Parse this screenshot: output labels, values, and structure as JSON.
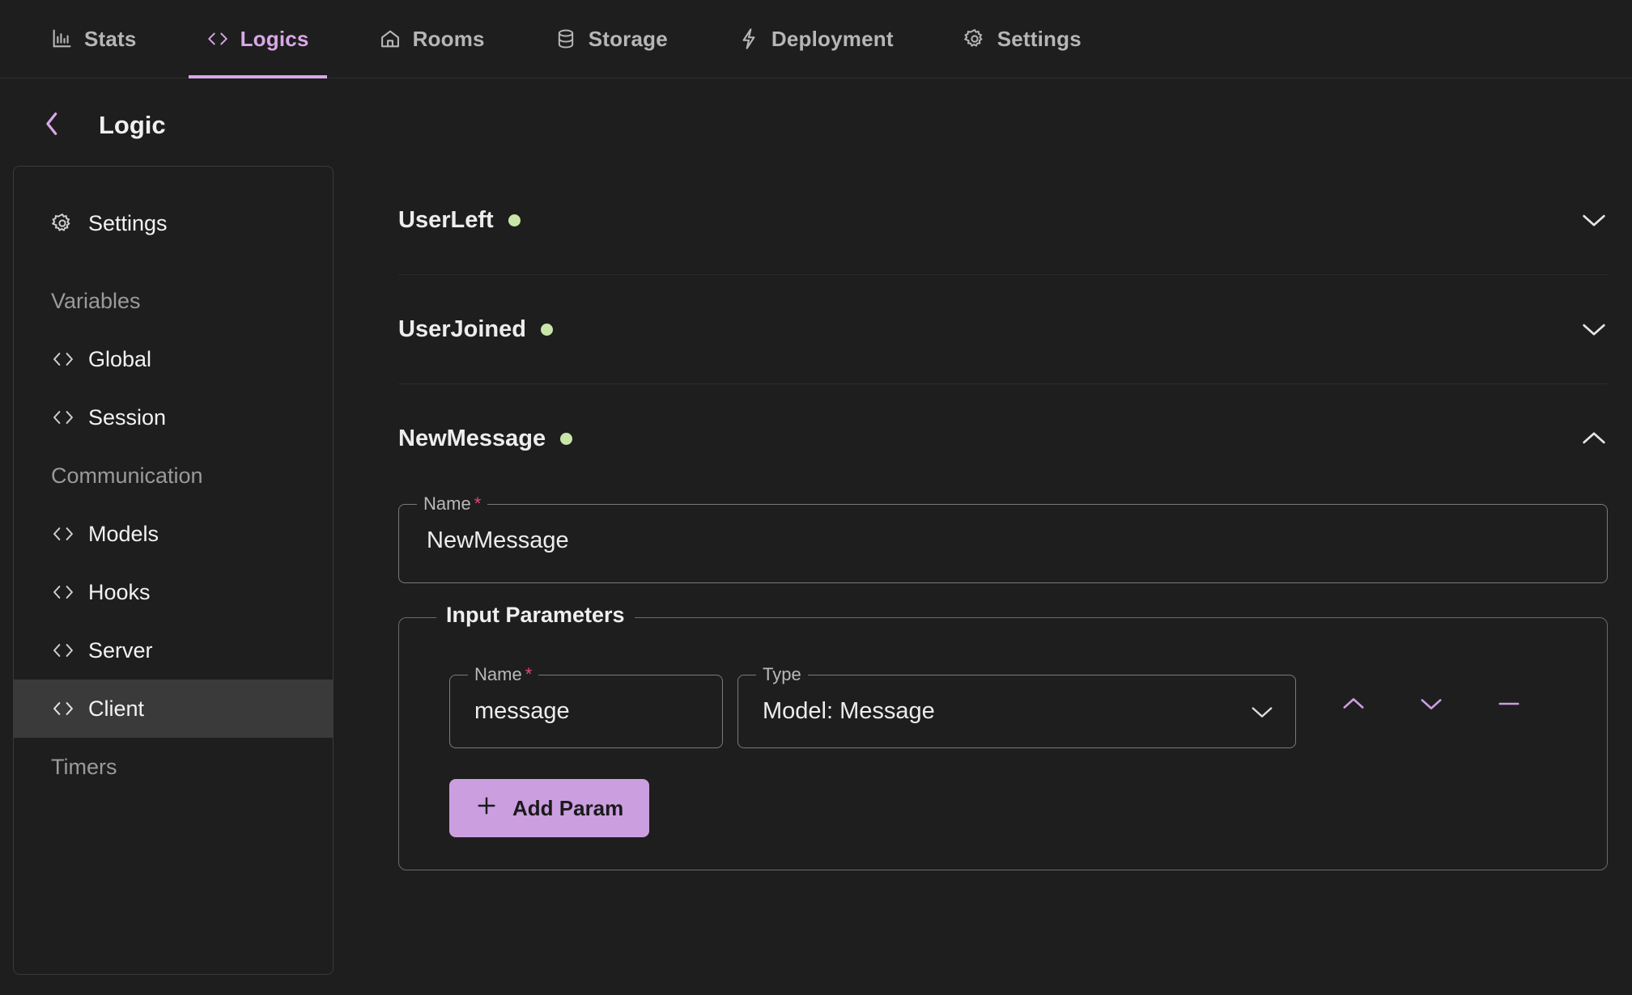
{
  "colors": {
    "accent": "#d9a8e8",
    "button": "#cb9ee0",
    "status_dot": "#c8e6a8",
    "required": "#e8447a",
    "background": "#1e1e1e",
    "selected_row": "#3a3a3a"
  },
  "topnav": {
    "items": [
      {
        "label": "Stats",
        "icon": "bar-chart-icon",
        "active": false
      },
      {
        "label": "Logics",
        "icon": "code-brackets-icon",
        "active": true
      },
      {
        "label": "Rooms",
        "icon": "home-icon",
        "active": false
      },
      {
        "label": "Storage",
        "icon": "database-icon",
        "active": false
      },
      {
        "label": "Deployment",
        "icon": "lightning-bolt-icon",
        "active": false
      },
      {
        "label": "Settings",
        "icon": "gear-icon",
        "active": false
      }
    ]
  },
  "header": {
    "back_icon": "chevron-left-icon",
    "title": "Logic"
  },
  "sidebar": {
    "items": [
      {
        "label": "Settings",
        "icon": "gear-icon",
        "type": "item",
        "selected": false
      },
      {
        "label": "Variables",
        "icon": "",
        "type": "group",
        "selected": false
      },
      {
        "label": "Global",
        "icon": "code-brackets-icon",
        "type": "item",
        "selected": false
      },
      {
        "label": "Session",
        "icon": "code-brackets-icon",
        "type": "item",
        "selected": false
      },
      {
        "label": "Communication",
        "icon": "",
        "type": "group",
        "selected": false
      },
      {
        "label": "Models",
        "icon": "code-brackets-icon",
        "type": "item",
        "selected": false
      },
      {
        "label": "Hooks",
        "icon": "code-brackets-icon",
        "type": "item",
        "selected": false
      },
      {
        "label": "Server",
        "icon": "code-brackets-icon",
        "type": "item",
        "selected": false
      },
      {
        "label": "Client",
        "icon": "code-brackets-icon",
        "type": "item",
        "selected": true
      },
      {
        "label": "Timers",
        "icon": "",
        "type": "group",
        "selected": false
      }
    ]
  },
  "main": {
    "accordions": [
      {
        "title": "UserLeft",
        "status_dot": true,
        "expanded": false,
        "chevron": "chevron-down-icon"
      },
      {
        "title": "UserJoined",
        "status_dot": true,
        "expanded": false,
        "chevron": "chevron-down-icon"
      },
      {
        "title": "NewMessage",
        "status_dot": true,
        "expanded": true,
        "chevron": "chevron-up-icon"
      }
    ],
    "expanded_form": {
      "name_field": {
        "legend": "Name",
        "required_marker": "*",
        "value": "NewMessage"
      },
      "input_parameters": {
        "legend": "Input Parameters",
        "rows": [
          {
            "name_legend": "Name",
            "name_required_marker": "*",
            "name_value": "message",
            "type_legend": "Type",
            "type_value": "Model: Message",
            "type_chevron": "chevron-down-icon",
            "buttons": [
              {
                "name": "move-up-button",
                "icon": "chevron-up-icon"
              },
              {
                "name": "move-down-button",
                "icon": "chevron-down-icon"
              },
              {
                "name": "remove-param-button",
                "icon": "minus-icon"
              }
            ]
          }
        ],
        "add_param_label": "Add Param",
        "add_param_icon": "plus-icon"
      }
    }
  }
}
